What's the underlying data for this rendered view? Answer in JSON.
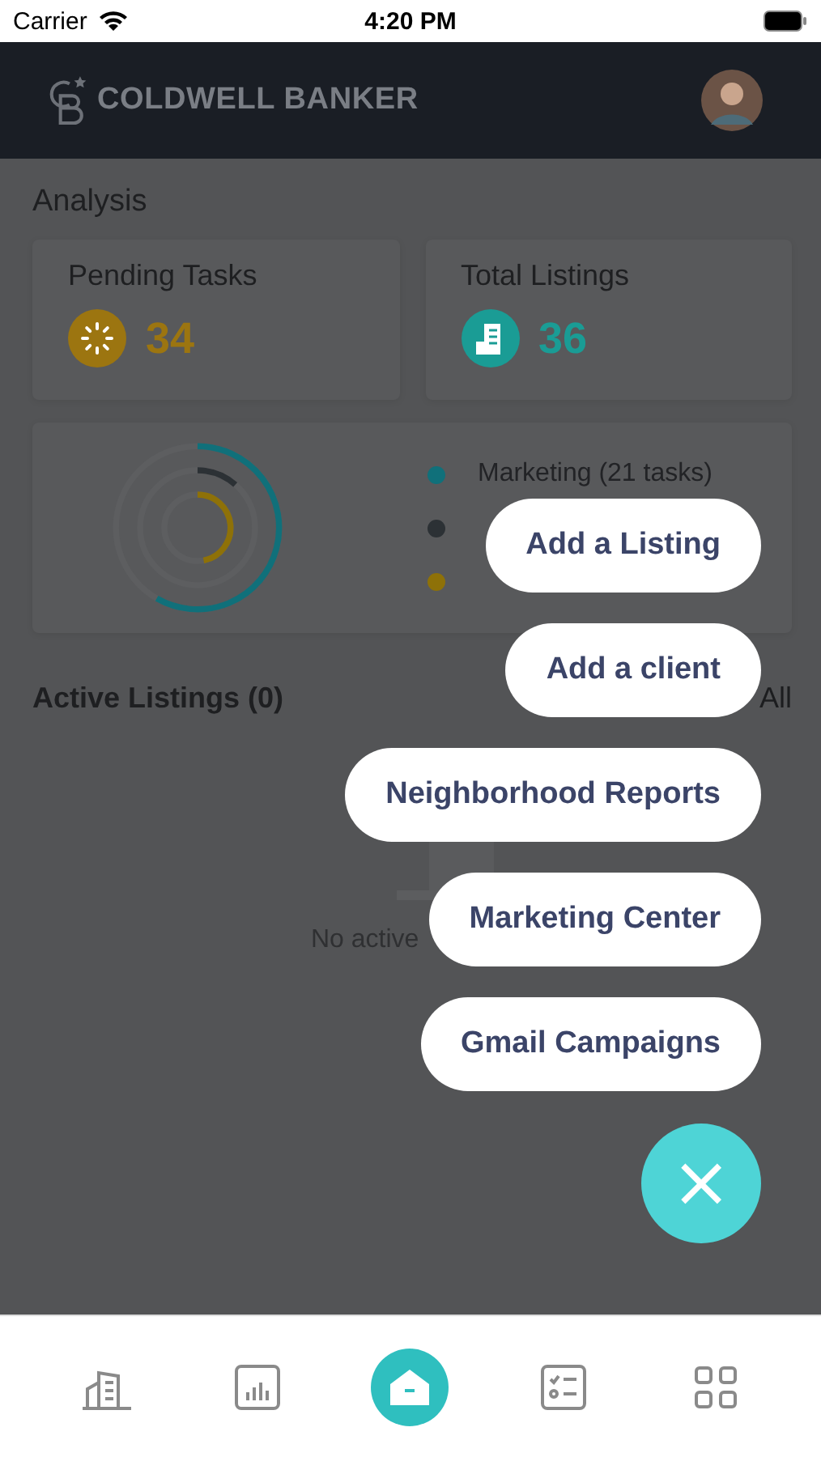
{
  "status_bar": {
    "carrier": "Carrier",
    "time": "4:20 PM"
  },
  "header": {
    "brand": "COLDWELL BANKER"
  },
  "analysis": {
    "title": "Analysis",
    "stats": [
      {
        "kind": "tasks",
        "label": "Pending Tasks",
        "value": "34",
        "color": "#9c7510"
      },
      {
        "kind": "listings",
        "label": "Total Listings",
        "value": "36",
        "color": "#1a9c95"
      }
    ],
    "legend": [
      {
        "label": "Marketing (21 tasks)",
        "color": "#10707a"
      },
      {
        "color": "#2c3135"
      },
      {
        "color": "#8e7108"
      }
    ]
  },
  "active_listings": {
    "title": "Active Listings (0)",
    "link": "All",
    "empty_text": "No active"
  },
  "menu": [
    "Add a Listing",
    "Add a client",
    "Neighborhood Reports",
    "Marketing Center",
    "Gmail Campaigns"
  ],
  "close_button": "×",
  "tabs": [
    {
      "kind": "listings",
      "selected": false
    },
    {
      "kind": "reports",
      "selected": false
    },
    {
      "kind": "home",
      "selected": true
    },
    {
      "kind": "tasks",
      "selected": false
    },
    {
      "kind": "more",
      "selected": false
    }
  ]
}
